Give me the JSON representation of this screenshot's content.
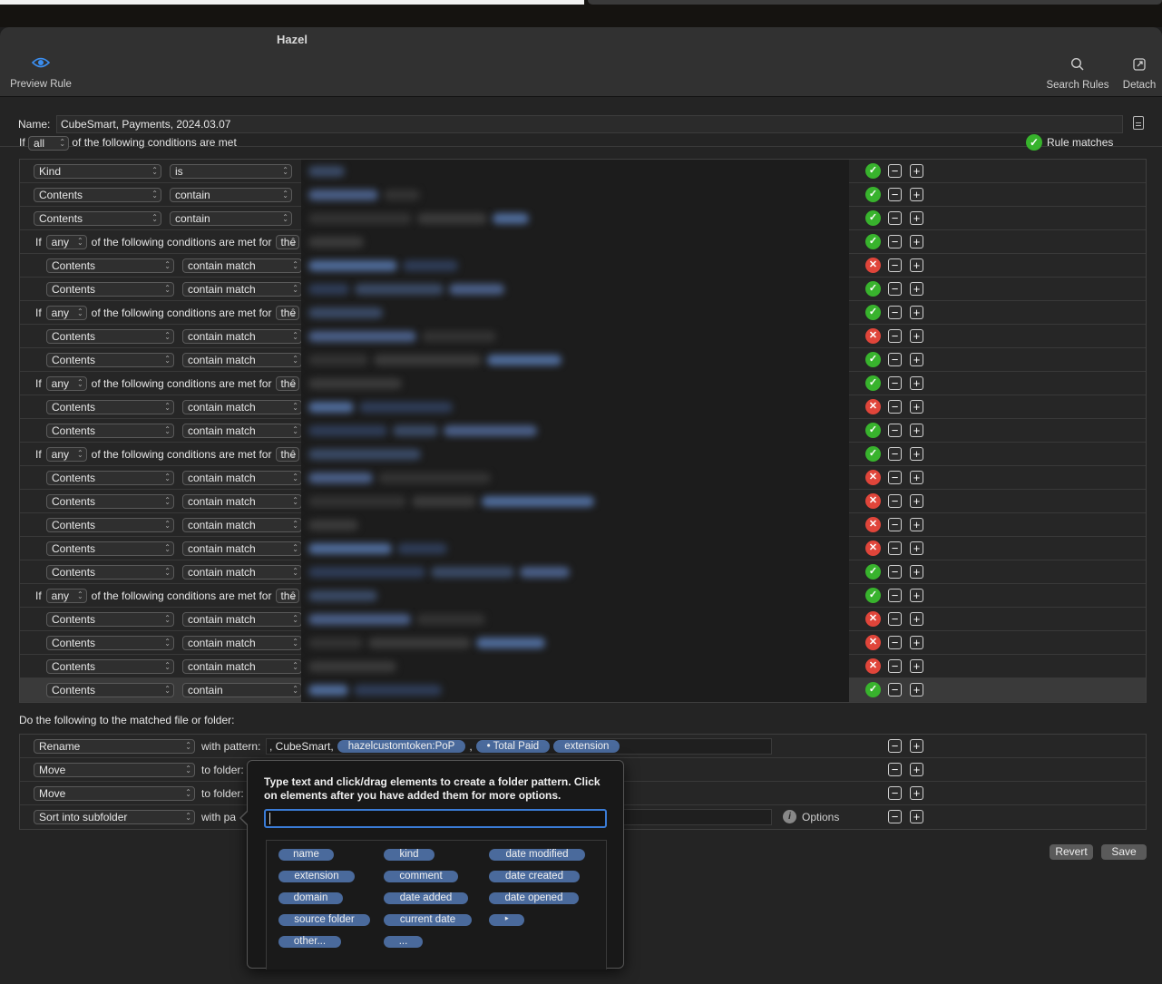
{
  "window": {
    "title": "Hazel"
  },
  "toolbar": {
    "preview_label": "Preview Rule",
    "search_label": "Search Rules",
    "detach_label": "Detach"
  },
  "rule_name": {
    "label": "Name:",
    "value": "CubeSmart, Payments, 2024.03.07"
  },
  "conditions_header": {
    "prefix": "If",
    "mode": "all",
    "suffix": "of the following conditions are met",
    "match_label": "Rule matches"
  },
  "nested_text": {
    "if": "If",
    "any": "any",
    "suffix": "of the following conditions are met for",
    "the": "the"
  },
  "conditions": [
    {
      "type": "cond",
      "indent": false,
      "attr": "Kind",
      "op": "is",
      "status": "ok"
    },
    {
      "type": "cond",
      "indent": false,
      "attr": "Contents",
      "op": "contain",
      "status": "ok"
    },
    {
      "type": "cond",
      "indent": false,
      "attr": "Contents",
      "op": "contain",
      "status": "ok"
    },
    {
      "type": "group",
      "status": "ok"
    },
    {
      "type": "cond",
      "indent": true,
      "attr": "Contents",
      "op": "contain match",
      "status": "bad"
    },
    {
      "type": "cond",
      "indent": true,
      "attr": "Contents",
      "op": "contain match",
      "status": "ok"
    },
    {
      "type": "group",
      "status": "ok"
    },
    {
      "type": "cond",
      "indent": true,
      "attr": "Contents",
      "op": "contain match",
      "status": "bad"
    },
    {
      "type": "cond",
      "indent": true,
      "attr": "Contents",
      "op": "contain match",
      "status": "ok"
    },
    {
      "type": "group",
      "status": "ok"
    },
    {
      "type": "cond",
      "indent": true,
      "attr": "Contents",
      "op": "contain match",
      "status": "bad"
    },
    {
      "type": "cond",
      "indent": true,
      "attr": "Contents",
      "op": "contain match",
      "status": "ok"
    },
    {
      "type": "group",
      "status": "ok"
    },
    {
      "type": "cond",
      "indent": true,
      "attr": "Contents",
      "op": "contain match",
      "status": "bad"
    },
    {
      "type": "cond",
      "indent": true,
      "attr": "Contents",
      "op": "contain match",
      "status": "bad"
    },
    {
      "type": "cond",
      "indent": true,
      "attr": "Contents",
      "op": "contain match",
      "status": "bad"
    },
    {
      "type": "cond",
      "indent": true,
      "attr": "Contents",
      "op": "contain match",
      "status": "bad"
    },
    {
      "type": "cond",
      "indent": true,
      "attr": "Contents",
      "op": "contain match",
      "status": "ok"
    },
    {
      "type": "group",
      "status": "ok"
    },
    {
      "type": "cond",
      "indent": true,
      "attr": "Contents",
      "op": "contain match",
      "status": "bad"
    },
    {
      "type": "cond",
      "indent": true,
      "attr": "Contents",
      "op": "contain match",
      "status": "bad"
    },
    {
      "type": "cond",
      "indent": true,
      "attr": "Contents",
      "op": "contain match",
      "status": "bad"
    },
    {
      "type": "cond",
      "indent": true,
      "attr": "Contents",
      "op": "contain",
      "status": "ok",
      "selected": true
    }
  ],
  "actions_header": "Do the following to the matched file or folder:",
  "actions": [
    {
      "action": "Rename",
      "target": "with pattern:"
    },
    {
      "action": "Move",
      "target": "to folder:"
    },
    {
      "action": "Move",
      "target": "to folder:"
    },
    {
      "action": "Sort into subfolder",
      "target": "with pa"
    }
  ],
  "rename_pattern": {
    "lead": ", CubeSmart,",
    "tok1": "hazelcustomtoken:PoP",
    "sep": ",",
    "tok2": "• Total Paid",
    "tok3": "extension"
  },
  "options_label": "Options",
  "buttons": {
    "revert": "Revert",
    "save": "Save"
  },
  "popover": {
    "instructions": "Type text and click/drag elements to create a folder pattern. Click on elements after you have added them for more options.",
    "elements": {
      "name": "name",
      "kind": "kind",
      "date_modified": "date modified",
      "extension": "extension",
      "comment": "comment",
      "date_created": "date created",
      "domain": "domain",
      "date_added": "date added",
      "date_opened": "date opened",
      "source_folder": "source folder",
      "current_date": "current date",
      "more": "‣",
      "other": "other...",
      "ellipsis": "..."
    }
  },
  "colors": {
    "ok": "#38b32d",
    "bad": "#e0453a",
    "token": "#4a6a9c",
    "focus": "#3a7bd5"
  }
}
